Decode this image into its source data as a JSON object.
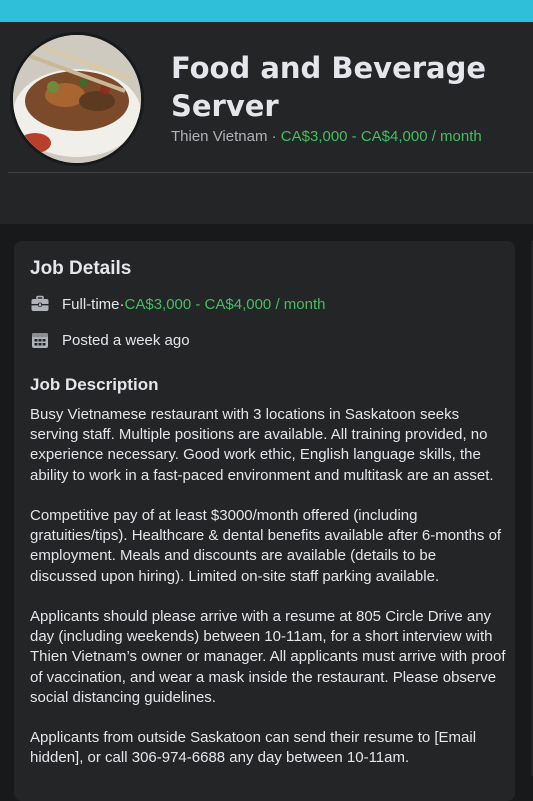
{
  "header": {
    "title": "Food and Beverage Server",
    "company": "Thien Vietnam",
    "separator": " · ",
    "salary": "CA$3,000 - CA$4,000 / month"
  },
  "job_details": {
    "heading": "Job Details",
    "job_type": "Full-time",
    "separator": " · ",
    "salary": "CA$3,000 - CA$4,000 / month",
    "posted": "Posted a week ago",
    "job_type_icon": "briefcase-icon",
    "posted_icon": "calendar-icon"
  },
  "job_description": {
    "heading": "Job Description",
    "paragraphs": [
      "Busy Vietnamese restaurant with 3 locations in Saskatoon seeks serving staff. Multiple positions are available. All training provided, no experience necessary. Good work ethic, English language skills, the ability to work in a fast-paced environment and multitask are an asset.",
      "Competitive pay of at least $3000/month offered (including gratuities/tips). Healthcare & dental benefits available after 6-months of employment. Meals and discounts are available (details to be discussed upon hiring). Limited on-site staff parking available.",
      "Applicants should please arrive with a resume at 805 Circle Drive any day (including weekends) between 10-11am, for a short interview with Thien Vietnam’s owner or manager. All applicants must arrive with proof of vaccination, and wear a mask inside the restaurant. Please observe social distancing guidelines.",
      "Applicants from outside Saskatoon can send their resume to [Email hidden], or call 306-974-6688 any day between 10-11am."
    ]
  },
  "colors": {
    "accent_bar": "#2fbfd9",
    "salary_green": "#45bd62",
    "card_bg": "#242526",
    "page_bg": "#18191a"
  }
}
